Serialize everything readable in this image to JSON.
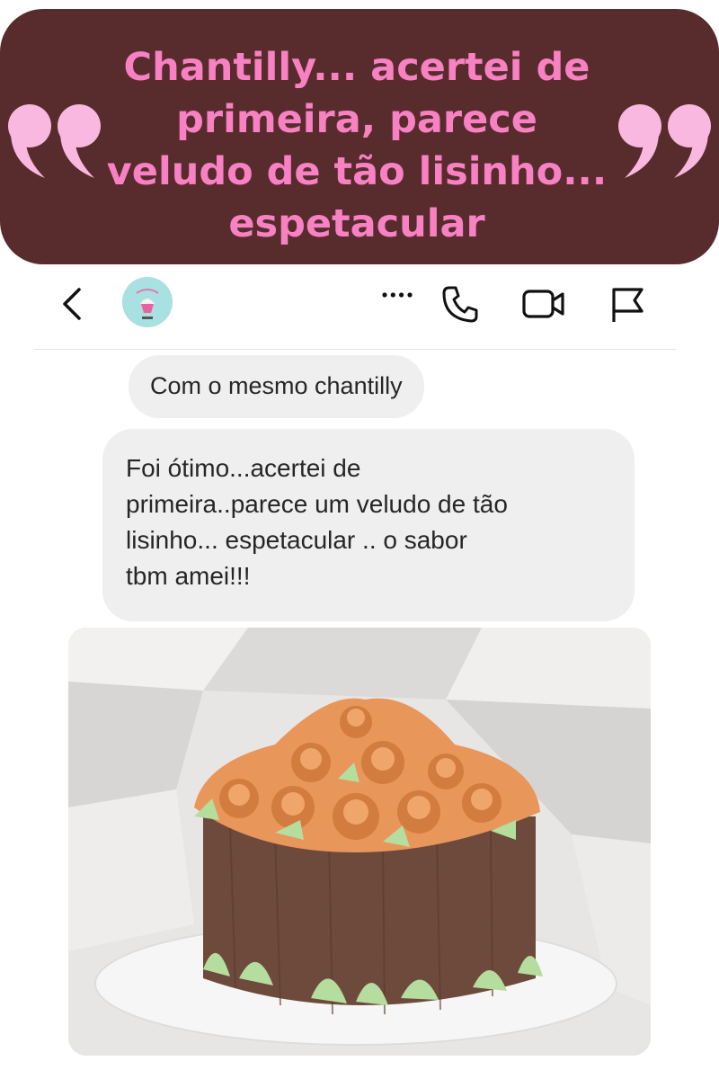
{
  "banner": {
    "quote_text": "Chantilly... acertei de\nprimeira, parece\nveludo de tão lisinho...\nespetacular",
    "background_color": "#582c2d",
    "text_color": "#f781c2"
  },
  "header": {
    "icons": [
      "back-icon",
      "avatar",
      "more-icon",
      "phone-icon",
      "video-icon",
      "flag-icon"
    ]
  },
  "messages": [
    {
      "text": "Com o mesmo chantilly"
    },
    {
      "text": "Foi ótimo...acertei de\nprimeira..parece um veludo de tão\nlisinho... espetacular .. o sabor\ntbm amei!!!"
    }
  ]
}
